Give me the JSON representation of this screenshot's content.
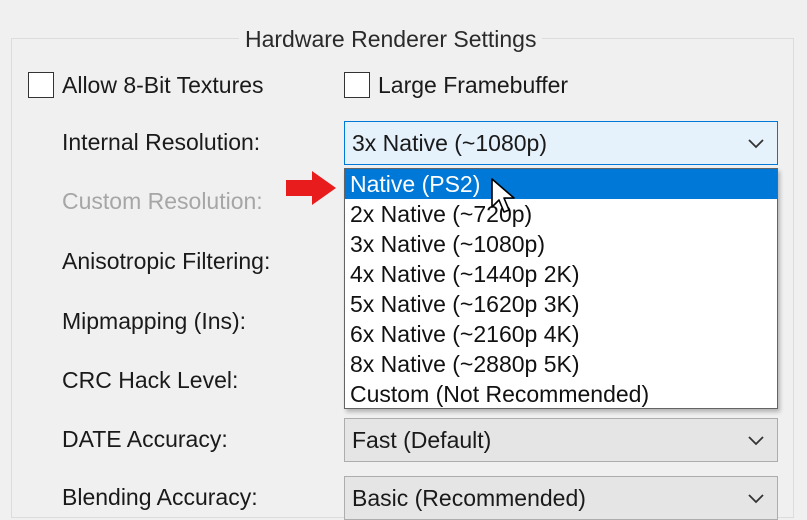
{
  "group": {
    "title": "Hardware Renderer Settings"
  },
  "checkboxes": [
    {
      "label": "Allow 8-Bit Textures",
      "checked": false
    },
    {
      "label": "Large Framebuffer",
      "checked": false
    }
  ],
  "settings": [
    {
      "label": "Internal Resolution:",
      "value": "3x Native (~1080p)"
    },
    {
      "label": "Custom Resolution:",
      "value": ""
    },
    {
      "label": "Anisotropic Filtering:",
      "value": ""
    },
    {
      "label": "Mipmapping (Ins):",
      "value": ""
    },
    {
      "label": "CRC Hack Level:",
      "value": ""
    },
    {
      "label": "DATE Accuracy:",
      "value": "Fast (Default)"
    },
    {
      "label": "Blending Accuracy:",
      "value": "Basic (Recommended)"
    }
  ],
  "dropdown": {
    "selected_index": 0,
    "options": [
      "Native (PS2)",
      "2x Native (~720p)",
      "3x Native (~1080p)",
      "4x Native (~1440p 2K)",
      "5x Native (~1620p 3K)",
      "6x Native (~2160p 4K)",
      "8x Native (~2880p 5K)",
      "Custom (Not Recommended)"
    ]
  },
  "icons": {
    "combo_chevron": "chevron-down-icon",
    "annotation": "red-arrow-icon",
    "pointer": "mouse-cursor-icon"
  },
  "colors": {
    "selection": "#0078d7",
    "active_combo_bg": "#e5f1fb",
    "arrow": "#e81c1c",
    "disabled_text": "#a6a6a6"
  }
}
